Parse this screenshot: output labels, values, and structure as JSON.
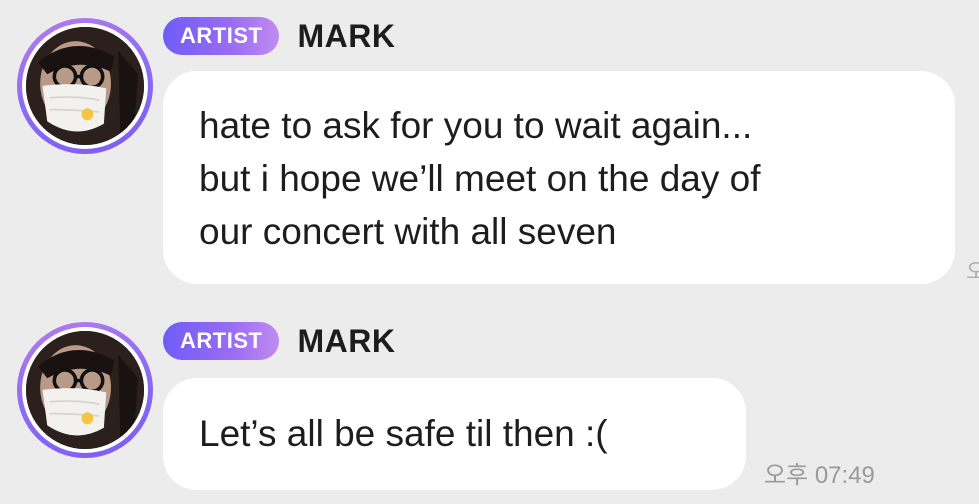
{
  "messages": [
    {
      "badge": "ARTIST",
      "sender": "MARK",
      "lines": [
        "hate to ask for you to wait again...",
        "but i hope we’ll meet on the day of",
        "our concert with all seven"
      ],
      "clipped_time": "오"
    },
    {
      "badge": "ARTIST",
      "sender": "MARK",
      "lines": [
        "Let’s all be safe til then :("
      ],
      "time": "오후 07:49"
    }
  ],
  "colors": {
    "background": "#ececec",
    "bubble": "#ffffff",
    "badge_start": "#6f5cf6",
    "badge_end": "#c08cf0",
    "avatar_ring": "#8b6cf2",
    "timestamp": "#9a9a9a"
  }
}
